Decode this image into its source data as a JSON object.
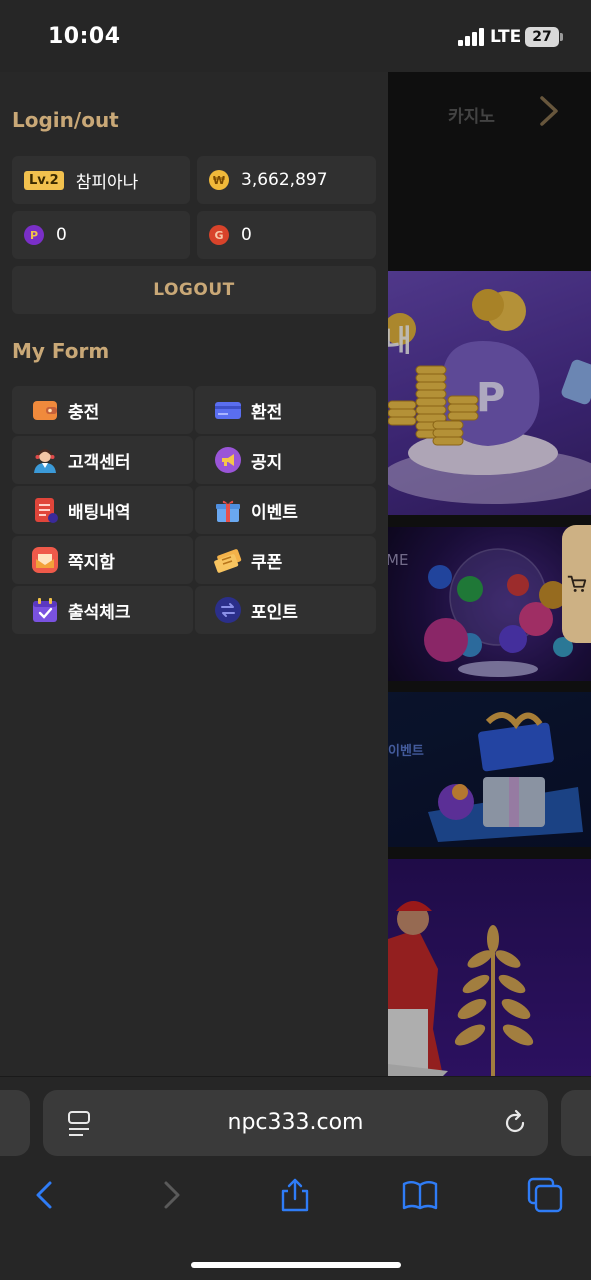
{
  "status_bar": {
    "time": "10:04",
    "network": "LTE",
    "battery": "27"
  },
  "background_page": {
    "casino_label": "카지노",
    "banner2_text": "ME",
    "banner3_text": "이벤트"
  },
  "drawer": {
    "login_title": "Login/out",
    "user": {
      "level": "Lv.2",
      "name": "참피아나",
      "money_icon": "₩",
      "money": "3,662,897",
      "point_icon": "P",
      "points": "0",
      "g_icon": "G",
      "g_value": "0"
    },
    "logout_label": "LOGOUT",
    "myform_title": "My Form",
    "menu": [
      {
        "label": "충전",
        "icon": "wallet-icon"
      },
      {
        "label": "환전",
        "icon": "card-icon"
      },
      {
        "label": "고객센터",
        "icon": "support-agent-icon"
      },
      {
        "label": "공지",
        "icon": "megaphone-icon"
      },
      {
        "label": "배팅내역",
        "icon": "document-icon"
      },
      {
        "label": "이벤트",
        "icon": "gift-icon"
      },
      {
        "label": "쪽지함",
        "icon": "mail-icon"
      },
      {
        "label": "쿠폰",
        "icon": "coupon-icon"
      },
      {
        "label": "출석체크",
        "icon": "calendar-check-icon"
      },
      {
        "label": "포인트",
        "icon": "exchange-icon"
      }
    ]
  },
  "browser": {
    "url": "npc333.com"
  },
  "colors": {
    "accent": "#c9a877",
    "card_bg": "#303030",
    "drawer_bg": "#282828",
    "ios_blue": "#2f7cf6"
  }
}
